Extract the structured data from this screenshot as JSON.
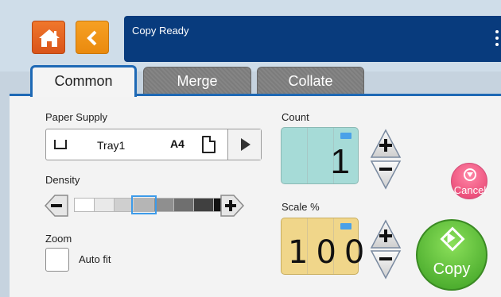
{
  "status": {
    "text": "Copy  Ready"
  },
  "tabs": [
    {
      "label": "Common",
      "selected": true
    },
    {
      "label": "Merge",
      "selected": false
    },
    {
      "label": "Collate",
      "selected": false
    }
  ],
  "paper_supply": {
    "label": "Paper Supply",
    "tray": "Tray1",
    "size": "A4",
    "orientation": "portrait"
  },
  "density": {
    "label": "Density",
    "levels": [
      "#ffffff",
      "#e9e9e9",
      "#cfcfcf",
      "#b5b5b5",
      "#8f8f8f",
      "#6f6f6f",
      "#404040",
      "#111111"
    ],
    "selected_index": 3
  },
  "zoom": {
    "label": "Zoom",
    "auto_fit_label": "Auto fit",
    "auto_fit_checked": false
  },
  "count": {
    "label": "Count",
    "value": "1"
  },
  "scale": {
    "label": "Scale %",
    "value": "100"
  },
  "actions": {
    "cancel_label": "Cancel",
    "copy_label": "Copy"
  },
  "colors": {
    "home": "#e4601f",
    "back": "#f19518",
    "status_bar": "#083b7d",
    "tab_accent": "#1e69b5",
    "count_bg": "#a6dbd7",
    "scale_bg": "#f0d68a",
    "cancel": "#ed4f7d",
    "copy": "#55b831"
  },
  "icons": [
    "home-icon",
    "back-arrow-icon",
    "menu-dots-icon",
    "tray-icon",
    "portrait-page-icon",
    "play-arrow-icon",
    "minus-icon",
    "plus-icon",
    "keyboard-icon",
    "cancel-icon",
    "start-icon"
  ]
}
